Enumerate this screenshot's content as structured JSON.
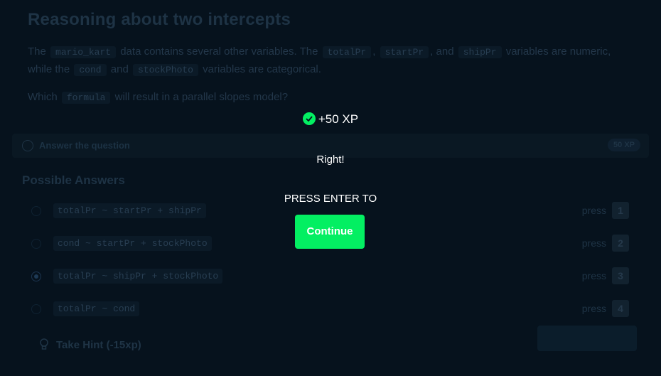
{
  "lesson": {
    "title": "Reasoning about two intercepts",
    "para1": {
      "t1": "The",
      "c1": "mario_kart",
      "t2": "data contains several other variables. The",
      "c2": "totalPr",
      "t3": ",",
      "c3": "startPr",
      "t4": ", and",
      "c4": "shipPr",
      "t5": "variables are numeric, while the",
      "c5": "cond",
      "t6": "and",
      "c6": "stockPhoto",
      "t7": "variables are categorical."
    },
    "para2": {
      "t1": "Which",
      "c1": "formula",
      "t2": "will result in a parallel slopes model?"
    },
    "answer_bar": {
      "label": "Answer the question",
      "xp": "50 XP"
    },
    "possible_answers_title": "Possible Answers",
    "answers": [
      {
        "code": "totalPr ~ startPr + shipPr",
        "press": "press",
        "key": "1"
      },
      {
        "code": "cond ~ startPr + stockPhoto",
        "press": "press",
        "key": "2"
      },
      {
        "code": "totalPr ~ shipPr + stockPhoto",
        "press": "press",
        "key": "3",
        "selected": true
      },
      {
        "code": "totalPr ~ cond",
        "press": "press",
        "key": "4"
      }
    ],
    "hint": "Take Hint (-15xp)"
  },
  "overlay": {
    "xp": "+50 XP",
    "feedback": "Right!",
    "press_enter": "PRESS ENTER TO",
    "continue": "Continue"
  },
  "colors": {
    "accent": "#03ef62",
    "background": "#06121d"
  },
  "icons": [
    "check-circle-icon",
    "radio-icon",
    "lightbulb-icon"
  ]
}
